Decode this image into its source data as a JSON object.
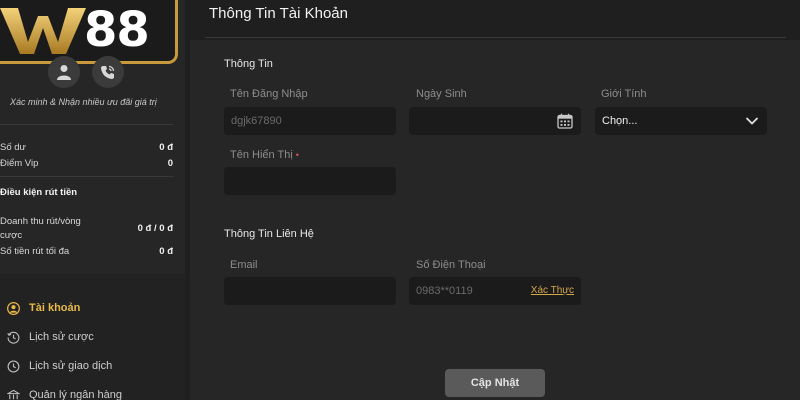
{
  "sidebar": {
    "logo": {
      "text": "88",
      "brand_colors": {
        "gold": "#c99a3c",
        "dark": "#1b1b1b"
      }
    },
    "action_icons": [
      "user-icon",
      "phone-icon"
    ],
    "promo_text": "Xác minh & Nhận nhiều ưu đãi giá trị",
    "balance": [
      {
        "label": "Số dư",
        "value": "0 đ"
      },
      {
        "label": "Điểm Vip",
        "value": "0"
      }
    ],
    "withdraw_title": "Điều kiện rút tiền",
    "withdraw": {
      "turnover_label_line1": "Doanh thu rút/vòng",
      "turnover_label_line2": "cược",
      "turnover_value": "0 đ / 0 đ",
      "max_label": "Số tiền rút tối đa",
      "max_value": "0 đ"
    },
    "nav": [
      {
        "label": "Tài khoản",
        "icon": "account-icon",
        "active": true
      },
      {
        "label": "Lịch sử cược",
        "icon": "history-icon",
        "active": false
      },
      {
        "label": "Lịch sử giao dịch",
        "icon": "transaction-icon",
        "active": false
      },
      {
        "label": "Quản lý ngân hàng",
        "icon": "bank-icon",
        "active": false
      }
    ]
  },
  "main": {
    "title": "Thông Tin Tài Khoản",
    "info_section": {
      "title": "Thông Tin",
      "username": {
        "label": "Tên Đăng Nhập",
        "value": "dgjk67890"
      },
      "birthday": {
        "label": "Ngày Sinh",
        "value": ""
      },
      "gender": {
        "label": "Giới Tính",
        "selected": "Chọn..."
      },
      "display_name": {
        "label": "Tên Hiển Thị",
        "required_mark": "•",
        "value": ""
      }
    },
    "contact_section": {
      "title": "Thông Tin Liên Hệ",
      "email": {
        "label": "Email",
        "value": ""
      },
      "phone": {
        "label": "Số Điện Thoại",
        "value": "0983**0119",
        "verify_label": "Xác Thực"
      }
    },
    "update_button": "Cập Nhật"
  },
  "colors": {
    "accent_gold": "#e8b84a",
    "link_gold": "#d6a64b",
    "required_red": "#d9534f",
    "background": "#1f1f1f",
    "card": "#262626",
    "input": "#1b1b1b"
  }
}
